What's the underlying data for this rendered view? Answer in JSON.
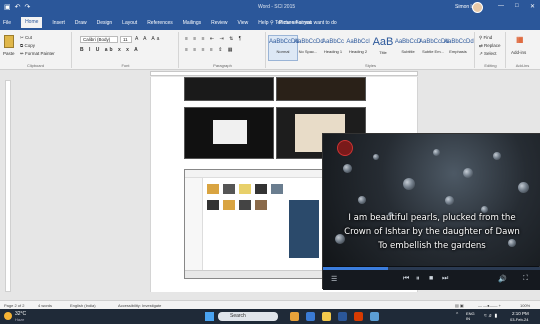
{
  "titlebar": {
    "title": "Word - SCI 2015",
    "user": "Simon lam",
    "save_icon": "save-icon",
    "undo_icon": "undo-icon",
    "redo_icon": "redo-icon"
  },
  "menu": {
    "tabs": [
      "File",
      "Home",
      "Insert",
      "Draw",
      "Design",
      "Layout",
      "References",
      "Mailings",
      "Review",
      "View",
      "Help",
      "Picture Format"
    ],
    "active": "Home",
    "tell_me": "Tell me what you want to do"
  },
  "ribbon": {
    "clipboard": {
      "paste": "Paste",
      "cut": "Cut",
      "copy": "Copy",
      "format_painter": "Format Painter",
      "label": "Clipboard"
    },
    "font": {
      "name": "Calibri (Body)",
      "size": "11",
      "label": "Font"
    },
    "paragraph": {
      "label": "Paragraph"
    },
    "styles": {
      "label": "Styles",
      "items": [
        {
          "sample": "AaBbCcDd",
          "name": "Normal"
        },
        {
          "sample": "AaBbCcDd",
          "name": "No Spac..."
        },
        {
          "sample": "AaBbCc",
          "name": "Heading 1"
        },
        {
          "sample": "AaBbCcl",
          "name": "Heading 2"
        },
        {
          "sample": "AaB",
          "name": "Title"
        },
        {
          "sample": "AaBbCcD",
          "name": "Subtitle"
        },
        {
          "sample": "AaBbCcDd",
          "name": "Subtle Em..."
        },
        {
          "sample": "AaBbCcDd",
          "name": "Emphasis"
        }
      ]
    },
    "editing": {
      "find": "Find",
      "replace": "Replace",
      "select": "Select",
      "label": "Editing"
    },
    "addins": {
      "label": "Add-ins",
      "button": "Add-ins"
    }
  },
  "video": {
    "caption_line1": "I am beautiful pearls, plucked from the",
    "caption_line2": "Crown of Ishtar by the daughter of Dawn",
    "caption_line3": "To embellish the gardens",
    "progress": 0.3
  },
  "status": {
    "page": "Page 2 of 2",
    "words": "4 words",
    "language": "English (India)",
    "accessibility": "Accessibility: Investigate",
    "zoom": "100%"
  },
  "taskbar": {
    "weather_temp": "32°C",
    "weather_text": "Haze",
    "search": "Search",
    "lang": "ENG IN",
    "time": "2:10 PM",
    "date": "03-Feb-24"
  }
}
